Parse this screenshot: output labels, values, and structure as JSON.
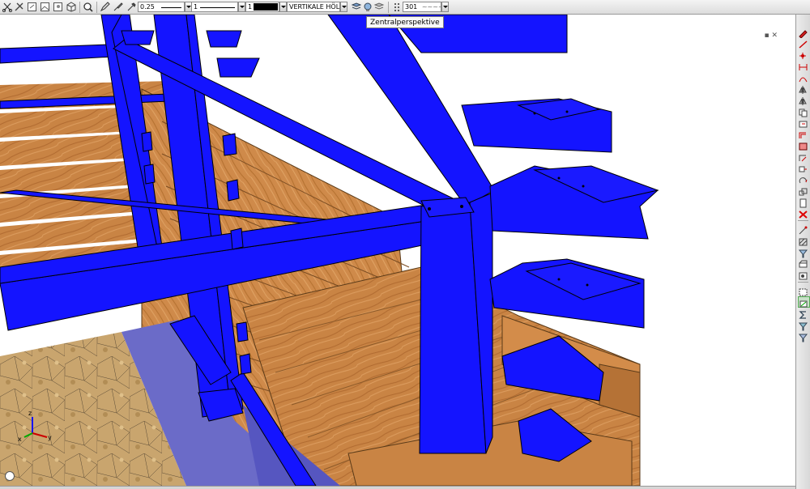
{
  "toolbar": {
    "pen_thickness": "0.25",
    "line_type": "1",
    "line_color": "1",
    "layer": "VERTIKALE HÖLZ",
    "view_number": "301",
    "view_pattern": "~~~~"
  },
  "tooltip": {
    "text": "Zentralperspektive"
  },
  "viewport": {
    "corner_buttons": "▪ ✕"
  },
  "axis": {
    "x": "x",
    "y": "y",
    "z": "z"
  },
  "colors": {
    "steel": "#1414ff",
    "wood": "#c97e3f",
    "ground": "#c9a36a",
    "toolbar": "#dedede"
  }
}
